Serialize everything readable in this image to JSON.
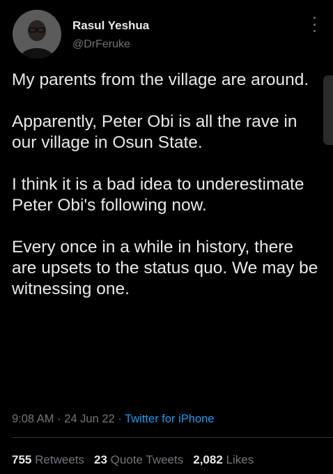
{
  "tweet": {
    "author": {
      "name": "Rasul Yeshua",
      "handle": "@DrFeruke",
      "avatar_icon": "profile-photo"
    },
    "paragraphs": [
      "My parents from the village are around.",
      "Apparently, Peter Obi is all the rave in our village in Osun State.",
      "I think it is a bad idea to underestimate Peter Obi's following now.",
      "Every once in a while in history, there are upsets to the status quo. We may be witnessing one."
    ],
    "time": "9:08 AM",
    "date": "24 Jun 22",
    "separator": "·",
    "source": "Twitter for iPhone",
    "stats": {
      "retweets_count": "755",
      "retweets_label": "Retweets",
      "quotes_count": "23",
      "quotes_label": "Quote Tweets",
      "likes_count": "2,082",
      "likes_label": "Likes"
    }
  },
  "colors": {
    "background": "#000000",
    "text": "#e7e9ea",
    "secondary": "#71767b",
    "accent": "#1d9bf0"
  },
  "icons": {
    "more": "more-vertical-icon"
  }
}
